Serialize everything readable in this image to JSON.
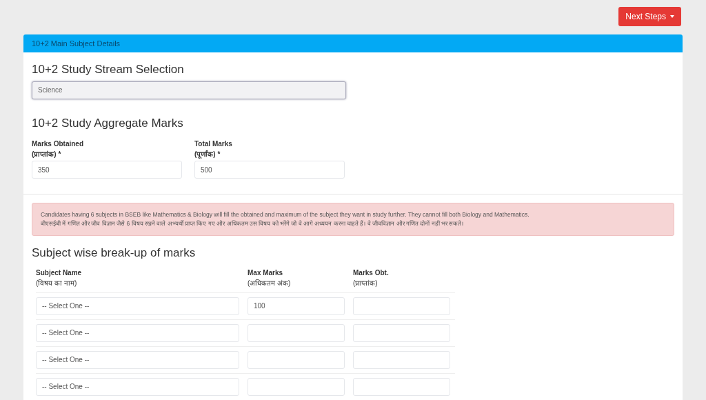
{
  "next_steps_button": "Next Steps",
  "panel": {
    "title": "10+2 Main Subject Details",
    "stream": {
      "heading": "10+2 Study Stream Selection",
      "value": "Science"
    },
    "aggregate": {
      "heading": "10+2 Study Aggregate Marks",
      "fields": [
        {
          "label": "Marks Obtained",
          "sublabel": "(प्राप्तांक) *",
          "value": "350"
        },
        {
          "label": "Total Marks",
          "sublabel": "(पूर्णांक) *",
          "value": "500"
        }
      ]
    },
    "notice": [
      "Candidates having 6 subjects in BSEB like Mathematics & Biology will fill the obtained and maximum of the subject they want in study further. They cannot fill both Biology and Mathematics.",
      "बीएसईबी में गणित और जीव विज्ञान जैसे 6 विषय रखने वाले अभ्यर्थी प्राप्त किए गए और अधिकतम उस विषय को भरेंगे जो वे आगे अध्ययन करना चाहते हैं। वे जीवविज्ञान और गणित दोनों नहीं भर सकते।"
    ],
    "breakup": {
      "heading": "Subject wise break-up of marks",
      "columns": [
        {
          "label": "Subject Name",
          "sublabel": "(विषय का नाम)"
        },
        {
          "label": "Max Marks",
          "sublabel": "(अधिकतम अंक)"
        },
        {
          "label": "Marks Obt.",
          "sublabel": "(प्राप्तांक)"
        }
      ],
      "rows": [
        {
          "subject": "-- Select One --",
          "max": "100"
        },
        {
          "subject": "-- Select One --"
        },
        {
          "subject": "-- Select One --"
        },
        {
          "subject": "-- Select One --"
        }
      ]
    }
  }
}
